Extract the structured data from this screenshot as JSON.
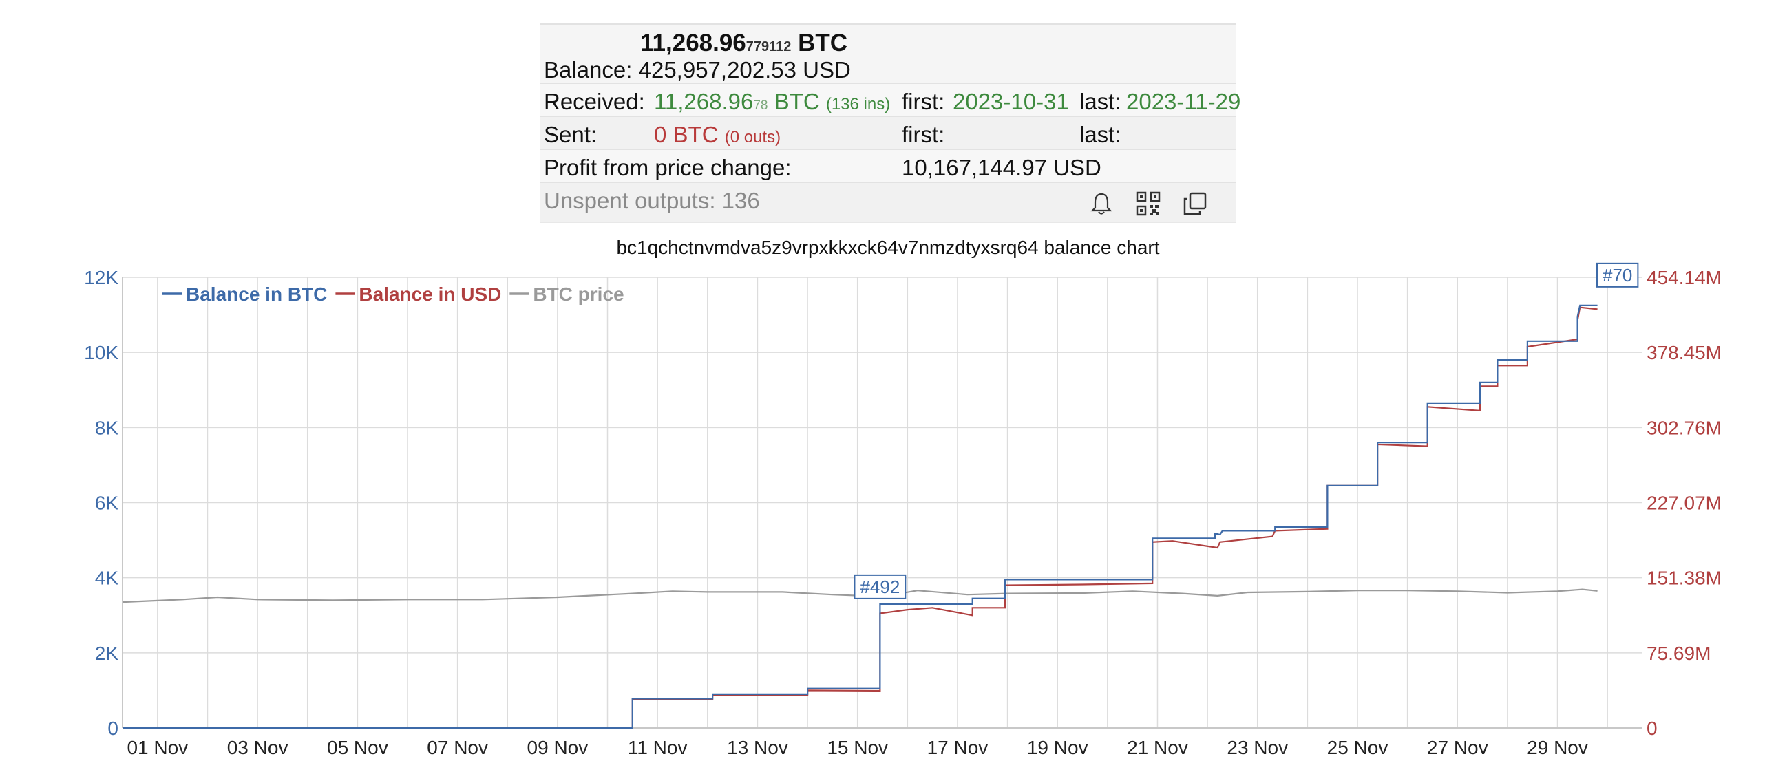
{
  "summary": {
    "balance_btc_main": "11,268.96",
    "balance_btc_small": "779112",
    "balance_btc_unit": "BTC",
    "balance_usd_label": "Balance:",
    "balance_usd_value": "425,957,202.53 USD",
    "received_label": "Received:",
    "received_main": "11,268.96",
    "received_small": "78",
    "received_unit": "BTC",
    "received_ins": "(136 ins)",
    "received_first_label": "first:",
    "received_first_value": "2023-10-31",
    "received_last_label": "last:",
    "received_last_value": "2023-11-29",
    "sent_label": "Sent:",
    "sent_value": "0 BTC",
    "sent_outs": "(0 outs)",
    "sent_first_label": "first:",
    "sent_last_label": "last:",
    "profit_label": "Profit from price change:",
    "profit_value": "10,167,144.97 USD",
    "unspent_label": "Unspent outputs: 136",
    "icons": [
      "bell-icon",
      "qr-code-icon",
      "copy-icon"
    ]
  },
  "chart_title": "bc1qchctnvmdva5z9vrpxkkxck64v7nmzdtyxsrq64 balance chart",
  "colors": {
    "btc": "#3d6aa8",
    "usd": "#b04040",
    "price": "#9a9a9a",
    "grid": "#dcdcdc"
  },
  "chart_data": {
    "type": "line",
    "legend": [
      {
        "name": "Balance in BTC",
        "color": "#3d6aa8"
      },
      {
        "name": "Balance in USD",
        "color": "#b04040"
      },
      {
        "name": "BTC price",
        "color": "#9a9a9a"
      }
    ],
    "legend_position": "top-left",
    "grid": true,
    "x_ticks": [
      "01 Nov",
      "03 Nov",
      "05 Nov",
      "07 Nov",
      "09 Nov",
      "11 Nov",
      "13 Nov",
      "15 Nov",
      "17 Nov",
      "19 Nov",
      "21 Nov",
      "23 Nov",
      "25 Nov",
      "27 Nov",
      "29 Nov"
    ],
    "x_range": [
      0.3,
      30.7
    ],
    "y_left_ticks": [
      "0",
      "2K",
      "4K",
      "6K",
      "8K",
      "10K",
      "12K"
    ],
    "y_left_range": [
      0,
      12000
    ],
    "y_right_ticks": [
      "0",
      "75.69M",
      "151.38M",
      "227.07M",
      "302.76M",
      "378.45M",
      "454.14M"
    ],
    "y_right_range": [
      0,
      454140000
    ],
    "annotations": [
      {
        "label": "#492",
        "x": 15.45,
        "y": 3300
      },
      {
        "label": "#70",
        "x": 30.2,
        "y": 11600
      }
    ],
    "series": [
      {
        "name": "Balance in BTC",
        "axis": "left",
        "points": [
          [
            0.3,
            0
          ],
          [
            10.5,
            0
          ],
          [
            10.5,
            780
          ],
          [
            12.1,
            780
          ],
          [
            12.1,
            900
          ],
          [
            14,
            900
          ],
          [
            14,
            1050
          ],
          [
            15.45,
            1050
          ],
          [
            15.45,
            3300
          ],
          [
            17.3,
            3300
          ],
          [
            17.3,
            3450
          ],
          [
            17.95,
            3450
          ],
          [
            17.95,
            3950
          ],
          [
            20.9,
            3950
          ],
          [
            20.9,
            5050
          ],
          [
            22.15,
            5050
          ],
          [
            22.15,
            5180
          ],
          [
            22.25,
            5150
          ],
          [
            22.3,
            5250
          ],
          [
            23.35,
            5250
          ],
          [
            23.35,
            5350
          ],
          [
            24.4,
            5350
          ],
          [
            24.4,
            6450
          ],
          [
            25.4,
            6450
          ],
          [
            25.4,
            7600
          ],
          [
            26.4,
            7600
          ],
          [
            26.4,
            8650
          ],
          [
            27.45,
            8650
          ],
          [
            27.45,
            9200
          ],
          [
            27.8,
            9200
          ],
          [
            27.8,
            9800
          ],
          [
            28.4,
            9800
          ],
          [
            28.4,
            10300
          ],
          [
            29.4,
            10300
          ],
          [
            29.4,
            10950
          ],
          [
            29.45,
            11250
          ],
          [
            29.8,
            11250
          ]
        ]
      },
      {
        "name": "Balance in USD",
        "axis": "left",
        "points": [
          [
            0.3,
            0
          ],
          [
            10.5,
            0
          ],
          [
            10.5,
            770
          ],
          [
            12.1,
            760
          ],
          [
            12.1,
            880
          ],
          [
            14,
            880
          ],
          [
            14,
            1000
          ],
          [
            15.45,
            990
          ],
          [
            15.45,
            3050
          ],
          [
            16.0,
            3150
          ],
          [
            16.5,
            3200
          ],
          [
            17.3,
            3000
          ],
          [
            17.3,
            3200
          ],
          [
            17.95,
            3200
          ],
          [
            17.95,
            3800
          ],
          [
            19.5,
            3820
          ],
          [
            20.9,
            3850
          ],
          [
            20.9,
            4950
          ],
          [
            21.3,
            4980
          ],
          [
            22.2,
            4800
          ],
          [
            22.25,
            4950
          ],
          [
            23.3,
            5100
          ],
          [
            23.35,
            5250
          ],
          [
            24.4,
            5300
          ],
          [
            24.4,
            6450
          ],
          [
            25.4,
            6450
          ],
          [
            25.4,
            7550
          ],
          [
            26.4,
            7500
          ],
          [
            26.4,
            8550
          ],
          [
            27.45,
            8450
          ],
          [
            27.45,
            9100
          ],
          [
            27.8,
            9100
          ],
          [
            27.8,
            9650
          ],
          [
            28.4,
            9650
          ],
          [
            28.4,
            10150
          ],
          [
            29.4,
            10350
          ],
          [
            29.4,
            10850
          ],
          [
            29.45,
            11200
          ],
          [
            29.8,
            11150
          ]
        ]
      },
      {
        "name": "BTC price",
        "axis": "left",
        "points": [
          [
            0.3,
            3350
          ],
          [
            1.5,
            3420
          ],
          [
            2.2,
            3480
          ],
          [
            3,
            3420
          ],
          [
            4.5,
            3400
          ],
          [
            6,
            3420
          ],
          [
            7.5,
            3420
          ],
          [
            9,
            3480
          ],
          [
            10.5,
            3580
          ],
          [
            11.3,
            3640
          ],
          [
            12,
            3620
          ],
          [
            13.5,
            3620
          ],
          [
            14.5,
            3550
          ],
          [
            15.5,
            3500
          ],
          [
            16.2,
            3660
          ],
          [
            17.2,
            3550
          ],
          [
            18,
            3580
          ],
          [
            19.5,
            3590
          ],
          [
            20.5,
            3640
          ],
          [
            21.5,
            3580
          ],
          [
            22.2,
            3520
          ],
          [
            22.8,
            3610
          ],
          [
            24,
            3630
          ],
          [
            25,
            3660
          ],
          [
            26,
            3660
          ],
          [
            27,
            3640
          ],
          [
            28,
            3600
          ],
          [
            29,
            3640
          ],
          [
            29.5,
            3690
          ],
          [
            29.8,
            3650
          ]
        ]
      }
    ]
  }
}
